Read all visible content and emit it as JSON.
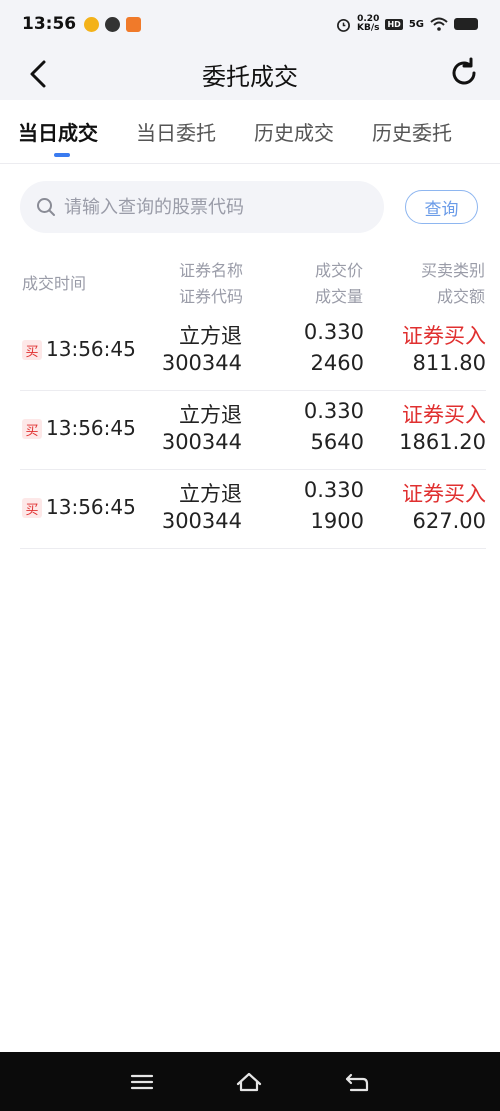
{
  "status_bar": {
    "time": "13:56",
    "net_speed_value": "0.20",
    "net_speed_unit": "KB/s",
    "hd_label": "HD",
    "signal_label": "5G"
  },
  "header": {
    "title": "委托成交"
  },
  "tabs": [
    {
      "label": "当日成交",
      "active": true
    },
    {
      "label": "当日委托",
      "active": false
    },
    {
      "label": "历史成交",
      "active": false
    },
    {
      "label": "历史委托",
      "active": false
    }
  ],
  "search": {
    "placeholder": "请输入查询的股票代码",
    "value": "",
    "button_label": "查询"
  },
  "table": {
    "headers": {
      "time": "成交时间",
      "name": "证券名称",
      "code": "证券代码",
      "price": "成交价",
      "volume": "成交量",
      "type": "买卖类别",
      "amount": "成交额"
    },
    "rows": [
      {
        "badge": "买",
        "time": "13:56:45",
        "name": "立方退",
        "code": "300344",
        "price": "0.330",
        "volume": "2460",
        "type": "证券买入",
        "amount": "811.80"
      },
      {
        "badge": "买",
        "time": "13:56:45",
        "name": "立方退",
        "code": "300344",
        "price": "0.330",
        "volume": "5640",
        "type": "证券买入",
        "amount": "1861.20"
      },
      {
        "badge": "买",
        "time": "13:56:45",
        "name": "立方退",
        "code": "300344",
        "price": "0.330",
        "volume": "1900",
        "type": "证券买入",
        "amount": "627.00"
      }
    ]
  },
  "colors": {
    "accent_blue": "#3a7bf0",
    "buy_red": "#e03030",
    "header_bg": "#f3f4f8"
  }
}
